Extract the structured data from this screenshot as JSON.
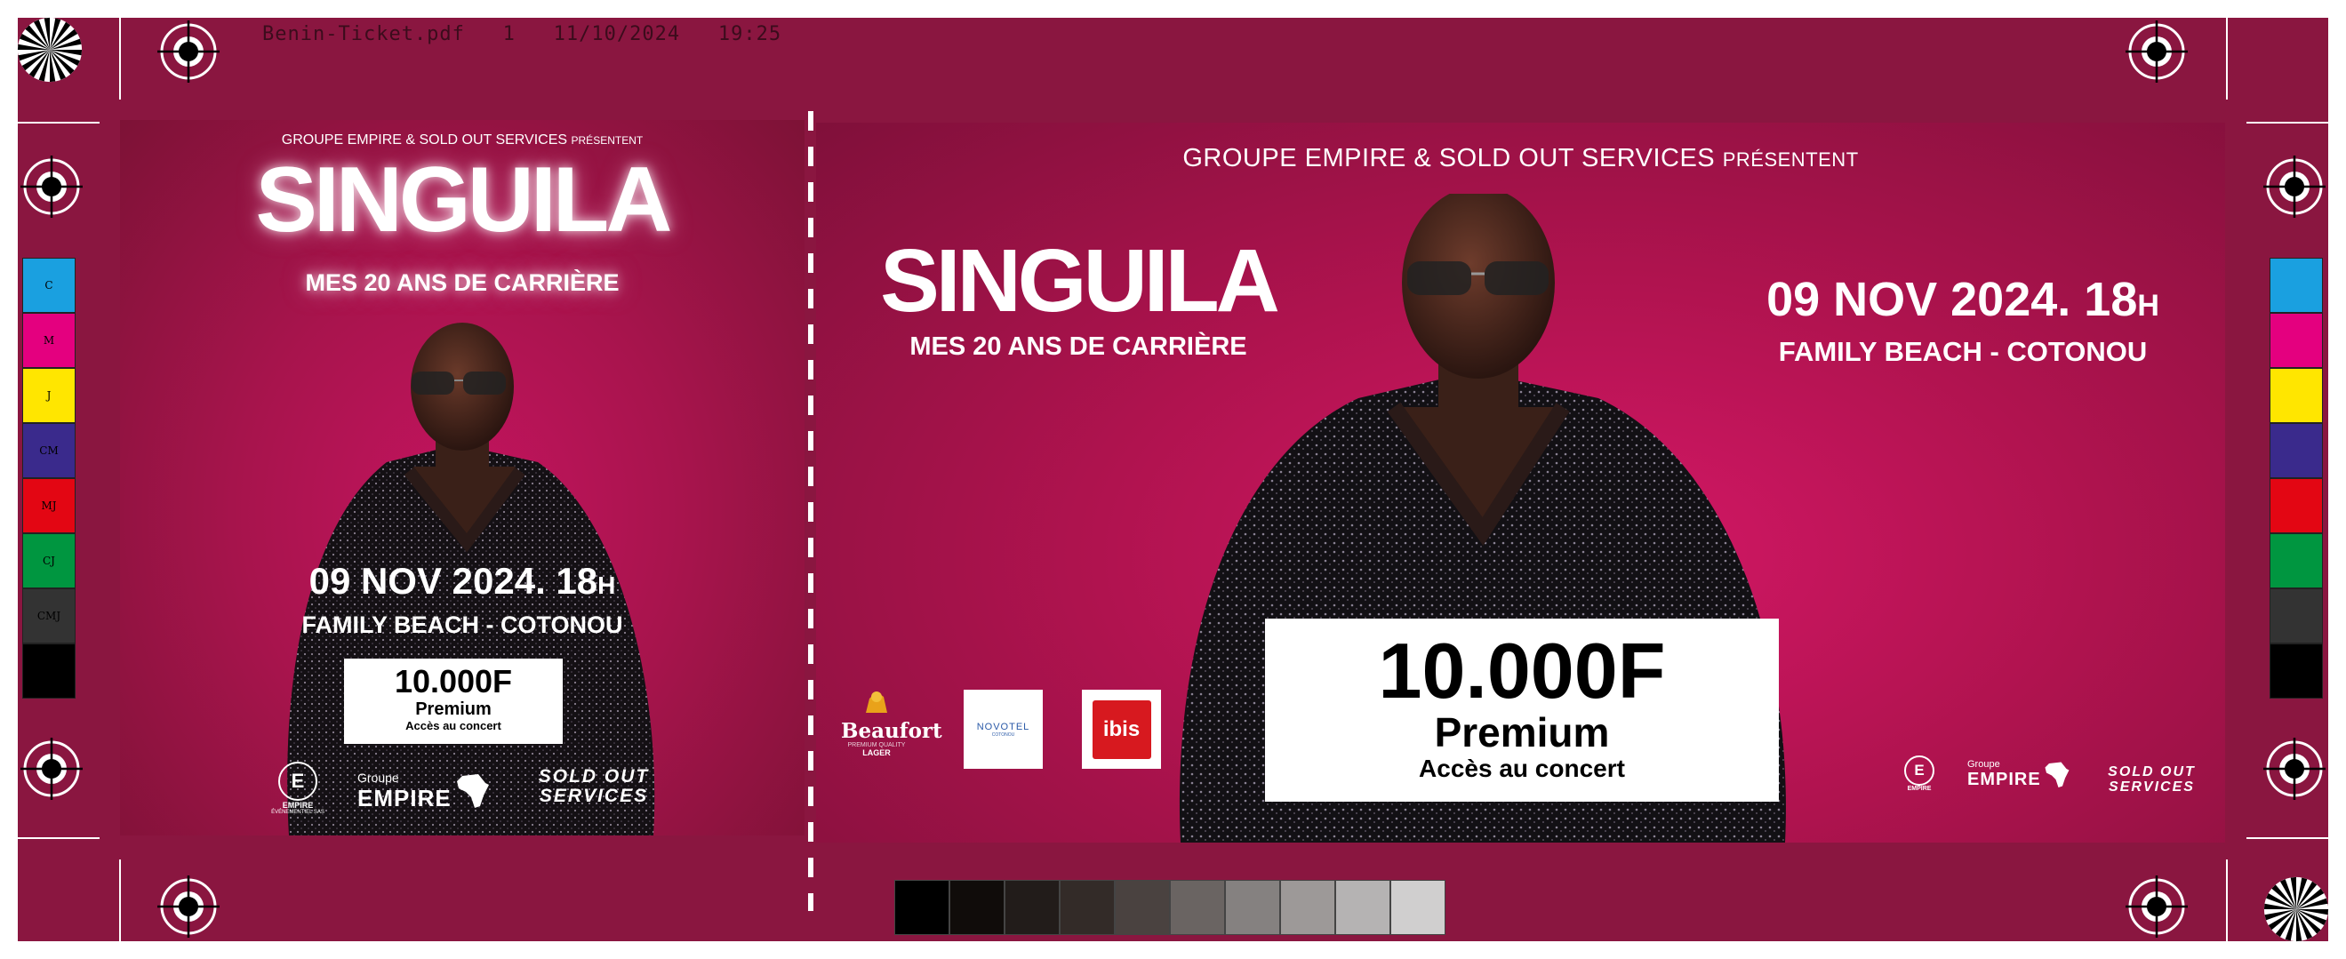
{
  "slug": {
    "filename": "Benin-Ticket.pdf",
    "page": "1",
    "date": "11/10/2024",
    "time": "19:25"
  },
  "color_bar": [
    "C",
    "M",
    "J",
    "CM",
    "MJ",
    "CJ",
    "CMJ",
    ""
  ],
  "colors": {
    "sheet": "#8a1640",
    "cyan": "#1aa0e0",
    "magenta": "#e4007f",
    "yellow": "#ffe600",
    "blue": "#3a2a8c",
    "red": "#e30613",
    "green": "#009640",
    "dark": "#333333",
    "black": "#000000"
  },
  "stub": {
    "presenters": "GROUPE EMPIRE & SOLD OUT SERVICES",
    "presents_word": "PRÉSENTENT",
    "artist": "SINGUILA",
    "tagline": "MES 20 ANS DE CARRIÈRE",
    "date": "09 NOV 2024. 18",
    "hour_unit": "H",
    "venue": "FAMILY BEACH - COTONOU",
    "price": "10.000F",
    "tier": "Premium",
    "access": "Accès au concert",
    "sponsors": {
      "empire_mark": "E",
      "empire_label": "EMPIRE",
      "empire_sub": "ÉVÉNEMENTIEL SAS",
      "groupe": "Groupe",
      "empire_word": "EMPIRE",
      "soldout_1": "SOLD OUT",
      "soldout_2": "SERVICES"
    }
  },
  "ticket": {
    "presenters": "GROUPE EMPIRE & SOLD OUT SERVICES",
    "presents_word": "PRÉSENTENT",
    "artist": "SINGUILA",
    "tagline": "MES 20 ANS DE CARRIÈRE",
    "date": "09 NOV 2024. 18",
    "hour_unit": "H",
    "venue": "FAMILY BEACH - COTONOU",
    "price": "10.000F",
    "tier": "Premium",
    "access": "Accès au concert",
    "partners": {
      "beaufort": "Beaufort",
      "beaufort_sub": "PREMIUM QUALITY",
      "beaufort_lager": "LAGER",
      "novotel": "NOVOTEL",
      "novotel_sub": "COTONOU",
      "ibis": "ibis"
    },
    "sponsors": {
      "empire_mark": "E",
      "empire_label": "EMPIRE",
      "groupe": "Groupe",
      "empire_word": "EMPIRE",
      "soldout_1": "SOLD OUT",
      "soldout_2": "SERVICES"
    }
  },
  "grayscale": [
    "#000000",
    "#100c0a",
    "#221c1a",
    "#332b28",
    "#4a4240",
    "#6a6462",
    "#858180",
    "#9d9998",
    "#b5b3b3",
    "#d0cfcf"
  ]
}
